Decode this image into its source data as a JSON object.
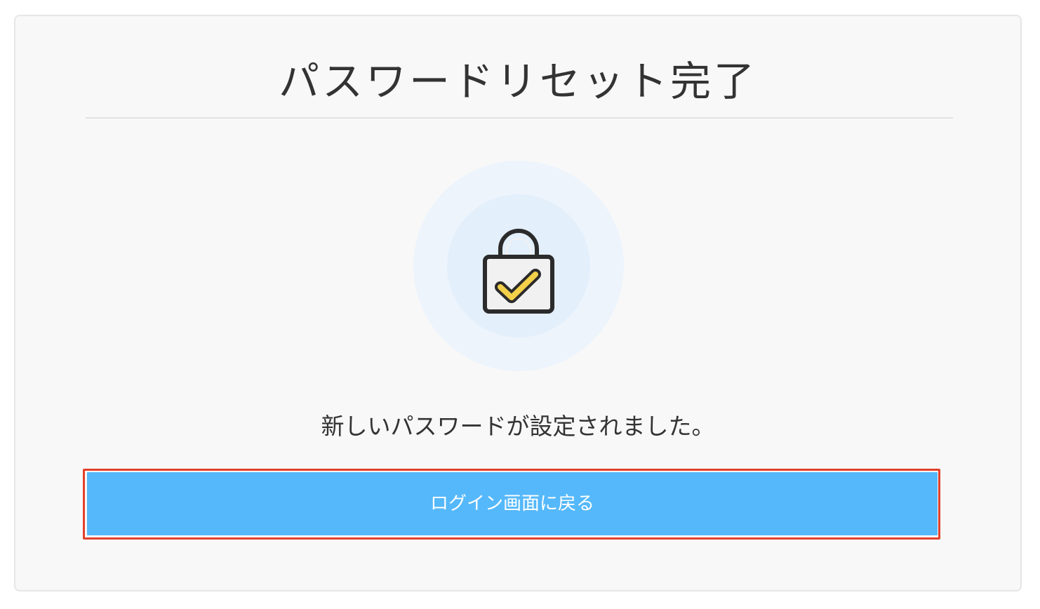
{
  "page": {
    "title": "パスワードリセット完了",
    "message": "新しいパスワードが設定されました。",
    "icon": "padlock-check-icon"
  },
  "actions": {
    "back_to_login_label": "ログイン画面に戻る"
  },
  "colors": {
    "button_bg": "#55b8fa",
    "highlight_border": "#e2412c",
    "check_fill": "#f3d04a"
  }
}
